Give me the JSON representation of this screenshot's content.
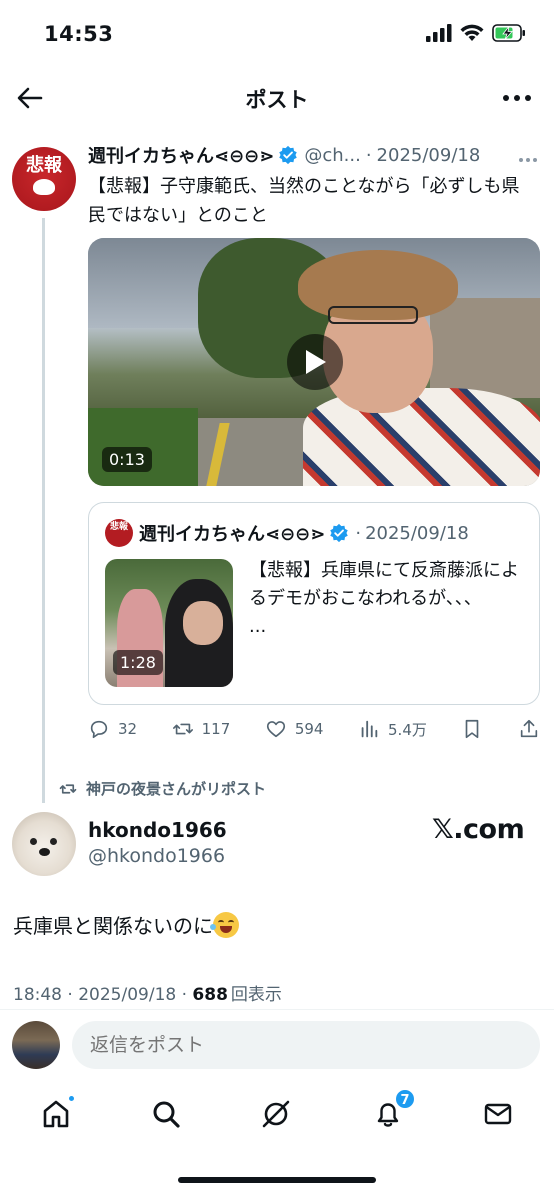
{
  "status_bar": {
    "time": "14:53"
  },
  "nav": {
    "title": "ポスト"
  },
  "quoted_tweet": {
    "avatar_text": "悲報",
    "name": "週刊イカちゃん⋖⊖⊖⋗",
    "handle": "@ch...",
    "separator": "·",
    "date": "2025/09/18",
    "text": "【悲報】子守康範氏、当然のことながら「必ずしも県民ではない」とのこと",
    "video_duration": "0:13",
    "quote": {
      "name": "週刊イカちゃん⋖⊖⊖⋗",
      "separator": "·",
      "date": "2025/09/18",
      "text": "【悲報】兵庫県にて反斎藤派によるデモがおこなわれるが、、、",
      "ellipsis": "...",
      "video_duration": "1:28"
    },
    "actions": {
      "replies": "32",
      "reposts": "117",
      "likes": "594",
      "views": "5.4万"
    }
  },
  "repost_banner": "神戸の夜景さんがリポスト",
  "main_tweet": {
    "name": "hkondo1966",
    "handle": "@hkondo1966",
    "watermark": "𝕏.com",
    "text": "兵庫県と関係ないのに",
    "emoji": "face-with-tears-of-joy",
    "time": "18:48",
    "separator1": " · ",
    "date": "2025/09/18",
    "separator2": " · ",
    "views_count": "688",
    "views_label": "回表示"
  },
  "reply_bar": {
    "placeholder": "返信をポスト"
  },
  "tab_bar": {
    "notifications_badge": "7"
  },
  "colors": {
    "accent": "#1d9bf0",
    "text": "#0f1419",
    "secondary": "#536471",
    "border": "#cfd9de"
  }
}
